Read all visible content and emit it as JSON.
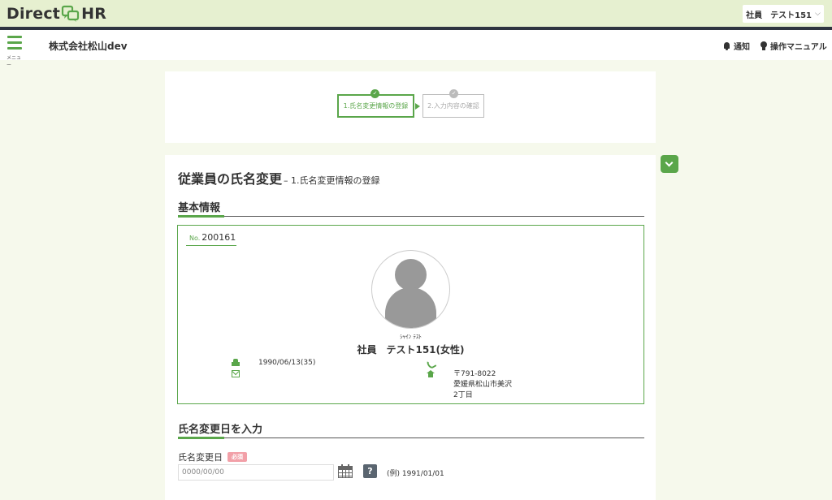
{
  "brand": {
    "name_left": "Direct",
    "name_right": "HR",
    "logo_icon": "chat-bubbles-logo",
    "accent_color": "#5aa64a"
  },
  "user_menu": {
    "label": "社員　テスト151"
  },
  "header": {
    "menu_label": "メニュー",
    "company": "株式会社松山dev",
    "notifications_label": "通知",
    "manual_label": "操作マニュアル"
  },
  "steps": [
    {
      "label": "1.氏名変更情報の登録",
      "state": "active"
    },
    {
      "label": "2.入力内容の確認",
      "state": "inactive"
    }
  ],
  "page": {
    "title": "従業員の氏名変更",
    "subtitle": "– 1.氏名変更情報の登録"
  },
  "basic_info": {
    "heading": "基本情報",
    "no_label": "No.",
    "employee_no": "200161",
    "kana": "ｼｬｲﾝ ﾃｽﾄ",
    "name": "社員　テスト151(女性)",
    "birth": "1990/06/13(35)",
    "email": "",
    "phone": "",
    "postal": "〒791-8022",
    "address_line1": "愛媛県松山市美沢",
    "address_line2": "2丁目"
  },
  "name_change": {
    "heading": "氏名変更日を入力",
    "field_label": "氏名変更日",
    "required_badge": "必須",
    "date_value": "",
    "date_placeholder": "0000/00/00",
    "help_label": "?",
    "example": "(例) 1991/01/01"
  }
}
